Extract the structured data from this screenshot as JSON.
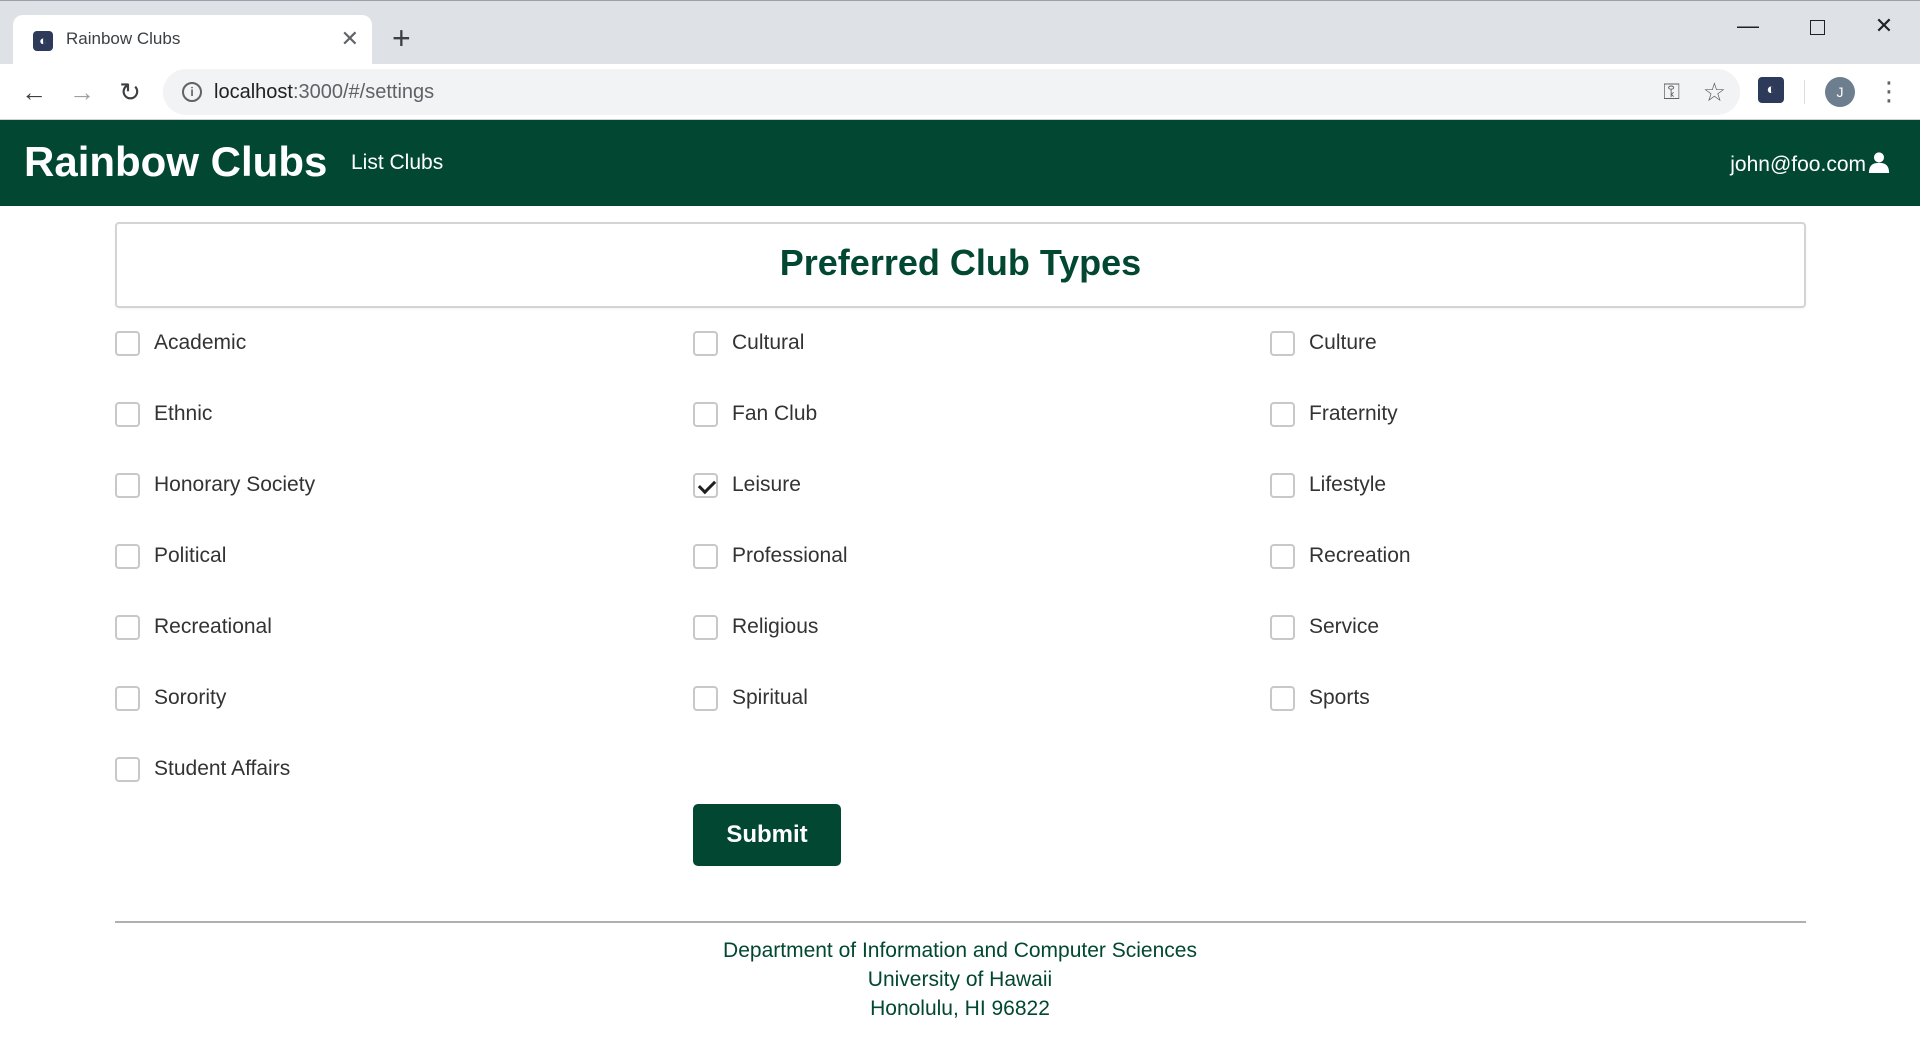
{
  "browser": {
    "tab_title": "Rainbow Clubs",
    "tab_close": "✕",
    "new_tab": "+",
    "url_host": "localhost",
    "url_rest": ":3000/#/settings",
    "avatar_letter": "J",
    "icons": [
      "back-icon",
      "forward-icon",
      "reload-icon",
      "info-icon",
      "key-icon",
      "star-icon",
      "extension-icon",
      "menu-icon"
    ]
  },
  "navbar": {
    "brand": "Rainbow Clubs",
    "list_clubs": "List Clubs",
    "user_email": "john@foo.com",
    "background_color": "#024731"
  },
  "page": {
    "title": "Preferred Club Types",
    "submit_label": "Submit"
  },
  "club_types": [
    {
      "label": "Academic",
      "checked": false
    },
    {
      "label": "Cultural",
      "checked": false
    },
    {
      "label": "Culture",
      "checked": false
    },
    {
      "label": "Ethnic",
      "checked": false
    },
    {
      "label": "Fan Club",
      "checked": false
    },
    {
      "label": "Fraternity",
      "checked": false
    },
    {
      "label": "Honorary Society",
      "checked": false
    },
    {
      "label": "Leisure",
      "checked": true
    },
    {
      "label": "Lifestyle",
      "checked": false
    },
    {
      "label": "Political",
      "checked": false
    },
    {
      "label": "Professional",
      "checked": false
    },
    {
      "label": "Recreation",
      "checked": false
    },
    {
      "label": "Recreational",
      "checked": false
    },
    {
      "label": "Religious",
      "checked": false
    },
    {
      "label": "Service",
      "checked": false
    },
    {
      "label": "Sorority",
      "checked": false
    },
    {
      "label": "Spiritual",
      "checked": false
    },
    {
      "label": "Sports",
      "checked": false
    },
    {
      "label": "Student Affairs",
      "checked": false
    }
  ],
  "footer": {
    "line1": "Department of Information and Computer Sciences",
    "line2": "University of Hawaii",
    "line3": "Honolulu, HI 96822"
  }
}
